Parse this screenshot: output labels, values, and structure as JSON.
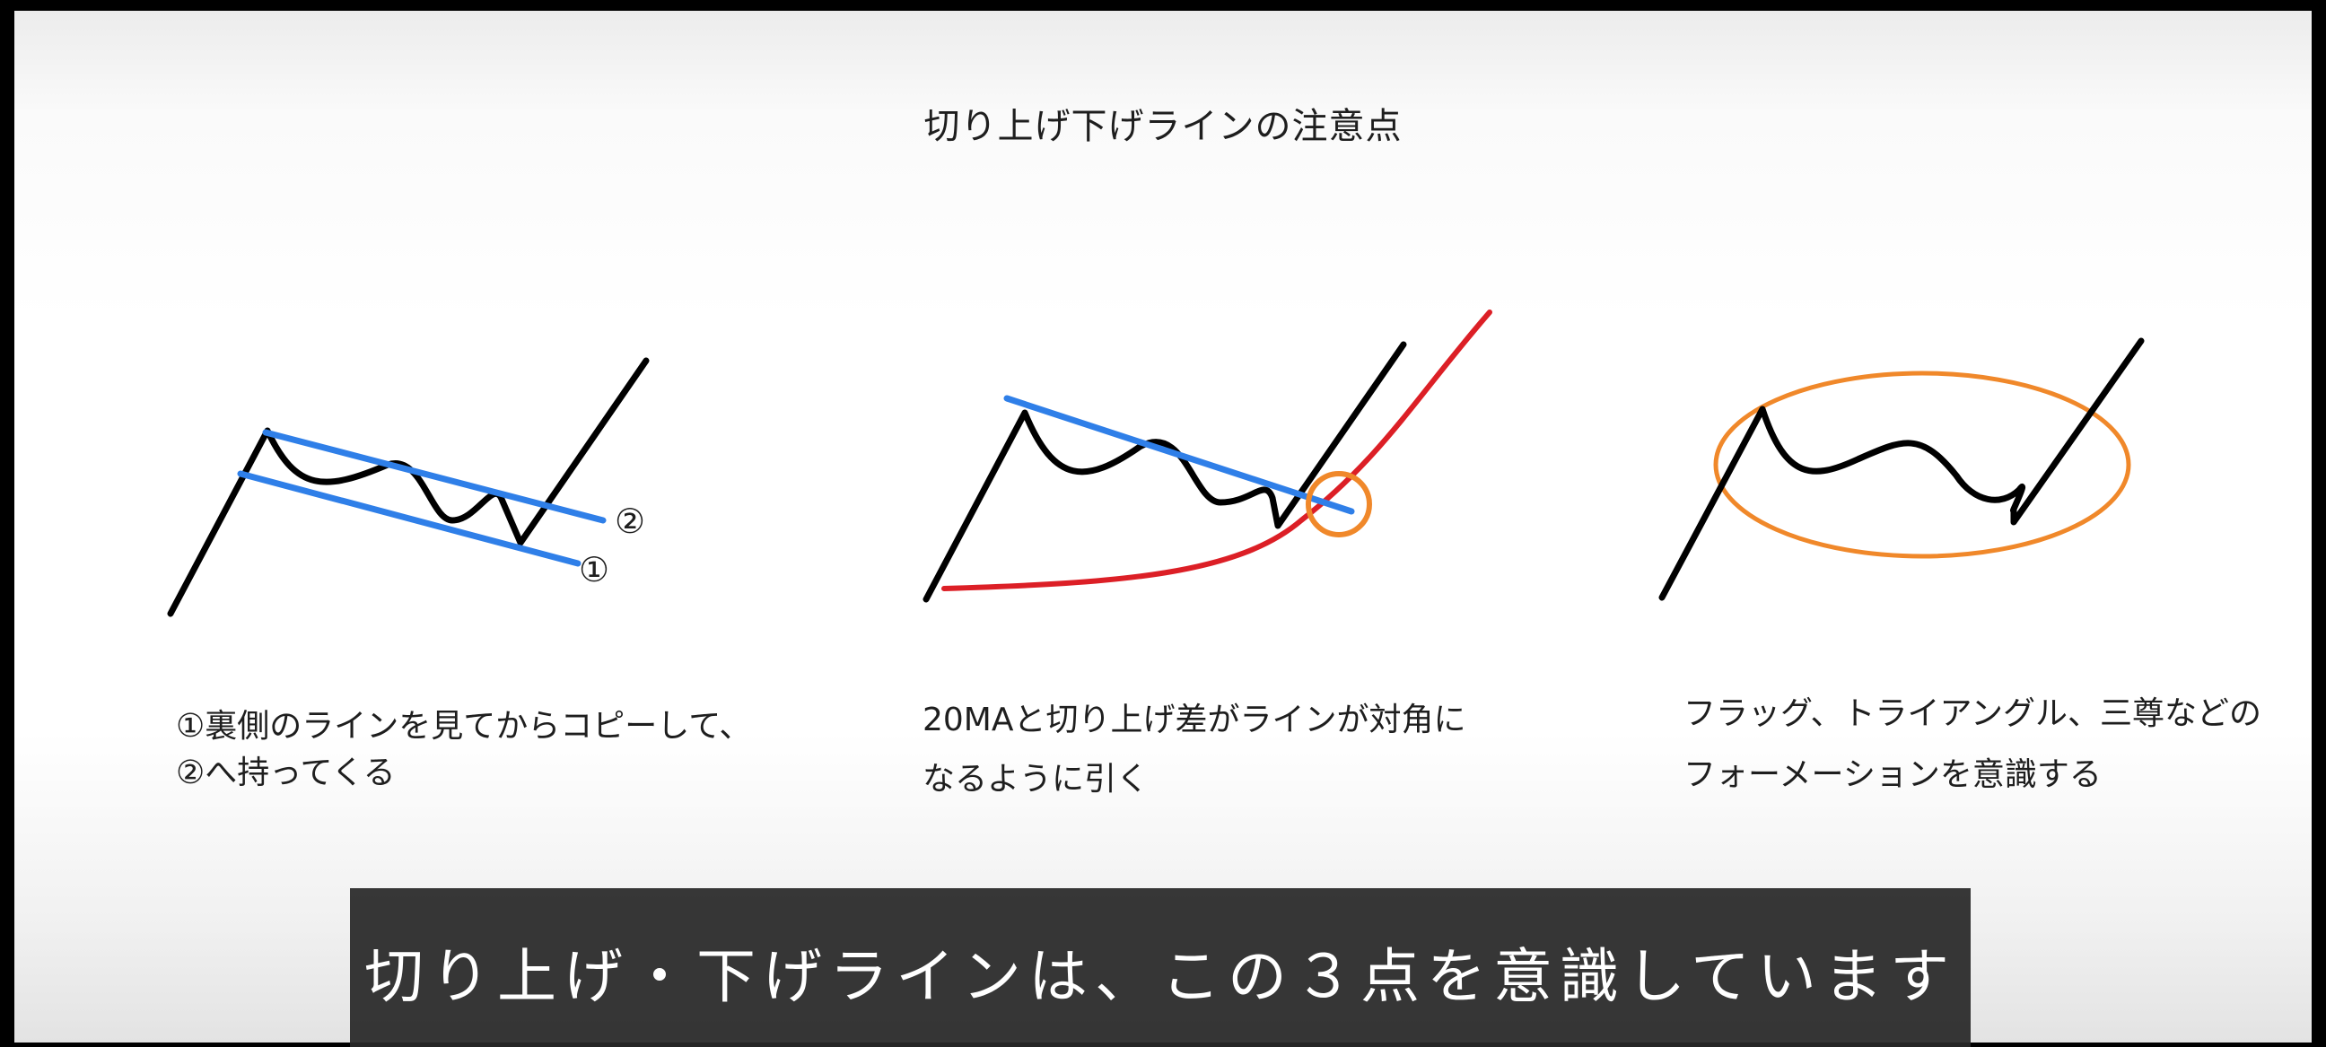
{
  "slide": {
    "title": "切り上げ下げラインの注意点"
  },
  "panels": [
    {
      "markers": [
        "②",
        "①"
      ],
      "caption_lines": [
        "①裏側のラインを見てからコピーして、",
        "②へ持ってくる"
      ]
    },
    {
      "caption_lines": [
        "20MAと切り上げ差がラインが対角に",
        "なるように引く"
      ]
    },
    {
      "caption_lines": [
        "フラッグ、トライアングル、三尊などの",
        "フォーメーションを意識する"
      ]
    }
  ],
  "subtitle": {
    "text": "切り上げ・下げラインは、この３点を意識しています"
  },
  "colors": {
    "price_line": "#000000",
    "trend_line": "#2f7fe8",
    "moving_average": "#dc1f26",
    "highlight": "#f0882a",
    "subtitle_bg": "#282828"
  }
}
